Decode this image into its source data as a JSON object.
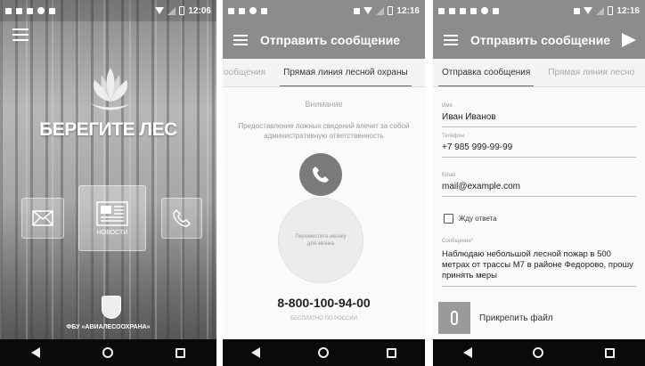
{
  "phone1": {
    "status_time": "12:06",
    "brand_title": "БЕРЕГИТЕ ЛЕС",
    "tile_news_label": "НОВОСТИ",
    "org_name": "ФБУ «АВИАЛЕСООХРАНА»"
  },
  "phone2": {
    "status_time": "12:16",
    "title": "Отправить сообщение",
    "tabs": [
      "сообщения",
      "Прямая линия лесной охраны"
    ],
    "attention": "Внимание",
    "warning": "Предоставление ложных сведений влечет за собой административную ответственность",
    "drag_hint": "Переместите иконку для звонка",
    "hotline": "8-800-100-94-00",
    "free_note": "БЕСПЛАТНО ПО РОССИИ"
  },
  "phone3": {
    "status_time": "12:16",
    "title": "Отправить сообщение",
    "tabs": [
      "Отправка сообщения",
      "Прямая линия лесно"
    ],
    "form": {
      "name_label": "Имя",
      "name_value": "Иван Иванов",
      "phone_label": "Телефон",
      "phone_value": "+7 985 999-99-99",
      "email_label": "Email",
      "email_value": "mail@example.com",
      "await_label": "Жду ответа",
      "message_label": "Сообщение*",
      "message_value": "Наблюдаю небольшой лесной пожар в 500 метрах от трассы М7 в районе Федорово, прошу принять меры",
      "attach_label": "Прикрепить файл"
    }
  },
  "icons": {
    "menu": "hamburger-icon",
    "mail": "mail-icon",
    "news": "news-icon",
    "phone": "phone-icon",
    "send": "send-icon",
    "attach": "paperclip-icon"
  },
  "colors": {
    "appbar": "#8c8c8c",
    "navbar": "#0a0a0a"
  }
}
